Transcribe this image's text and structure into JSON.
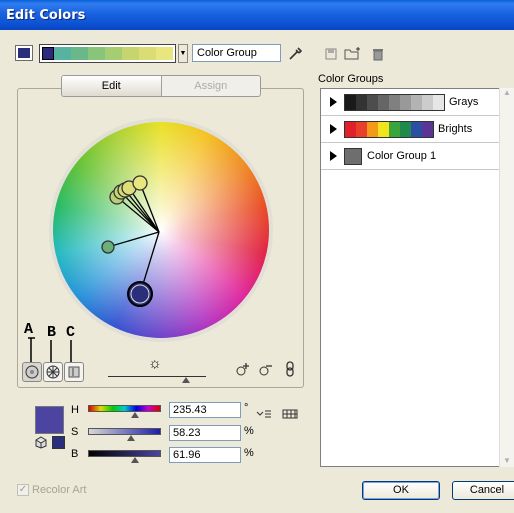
{
  "window": {
    "title": "Edit Colors"
  },
  "top": {
    "active_color": "#2b2e7a",
    "harmony_colors": [
      "#2d2a7d",
      "#55b3a0",
      "#6ab889",
      "#88c47a",
      "#a6cd72",
      "#c6d56f",
      "#dadd74",
      "#e9e57f"
    ],
    "group_name": "Color Group"
  },
  "tabs": {
    "edit": "Edit",
    "assign": "Assign"
  },
  "wheel": {
    "annotations": [
      "A",
      "B",
      "C"
    ]
  },
  "hsb": {
    "h_label": "H",
    "h_value": "235.43",
    "h_unit": "°",
    "s_label": "S",
    "s_value": "58.23",
    "s_unit": "%",
    "b_label": "B",
    "b_value": "61.96",
    "b_unit": "%",
    "swatch_color": "#4b44a0"
  },
  "groups": {
    "header": "Color Groups",
    "items": [
      {
        "name": "Grays",
        "colors": [
          "#1a1a1a",
          "#333333",
          "#4d4d4d",
          "#666666",
          "#808080",
          "#999999",
          "#b3b3b3",
          "#cccccc",
          "#e6e6e6"
        ]
      },
      {
        "name": "Brights",
        "colors": [
          "#e0202a",
          "#e8402a",
          "#f39a1a",
          "#f2e41c",
          "#3aa53c",
          "#1f8a4c",
          "#2a4fa3",
          "#5b3596"
        ]
      },
      {
        "name": "Color Group 1",
        "colors": [
          "#6e6e6e"
        ]
      }
    ]
  },
  "footer": {
    "recolor_label": "Recolor Art",
    "ok": "OK",
    "cancel": "Cancel"
  }
}
